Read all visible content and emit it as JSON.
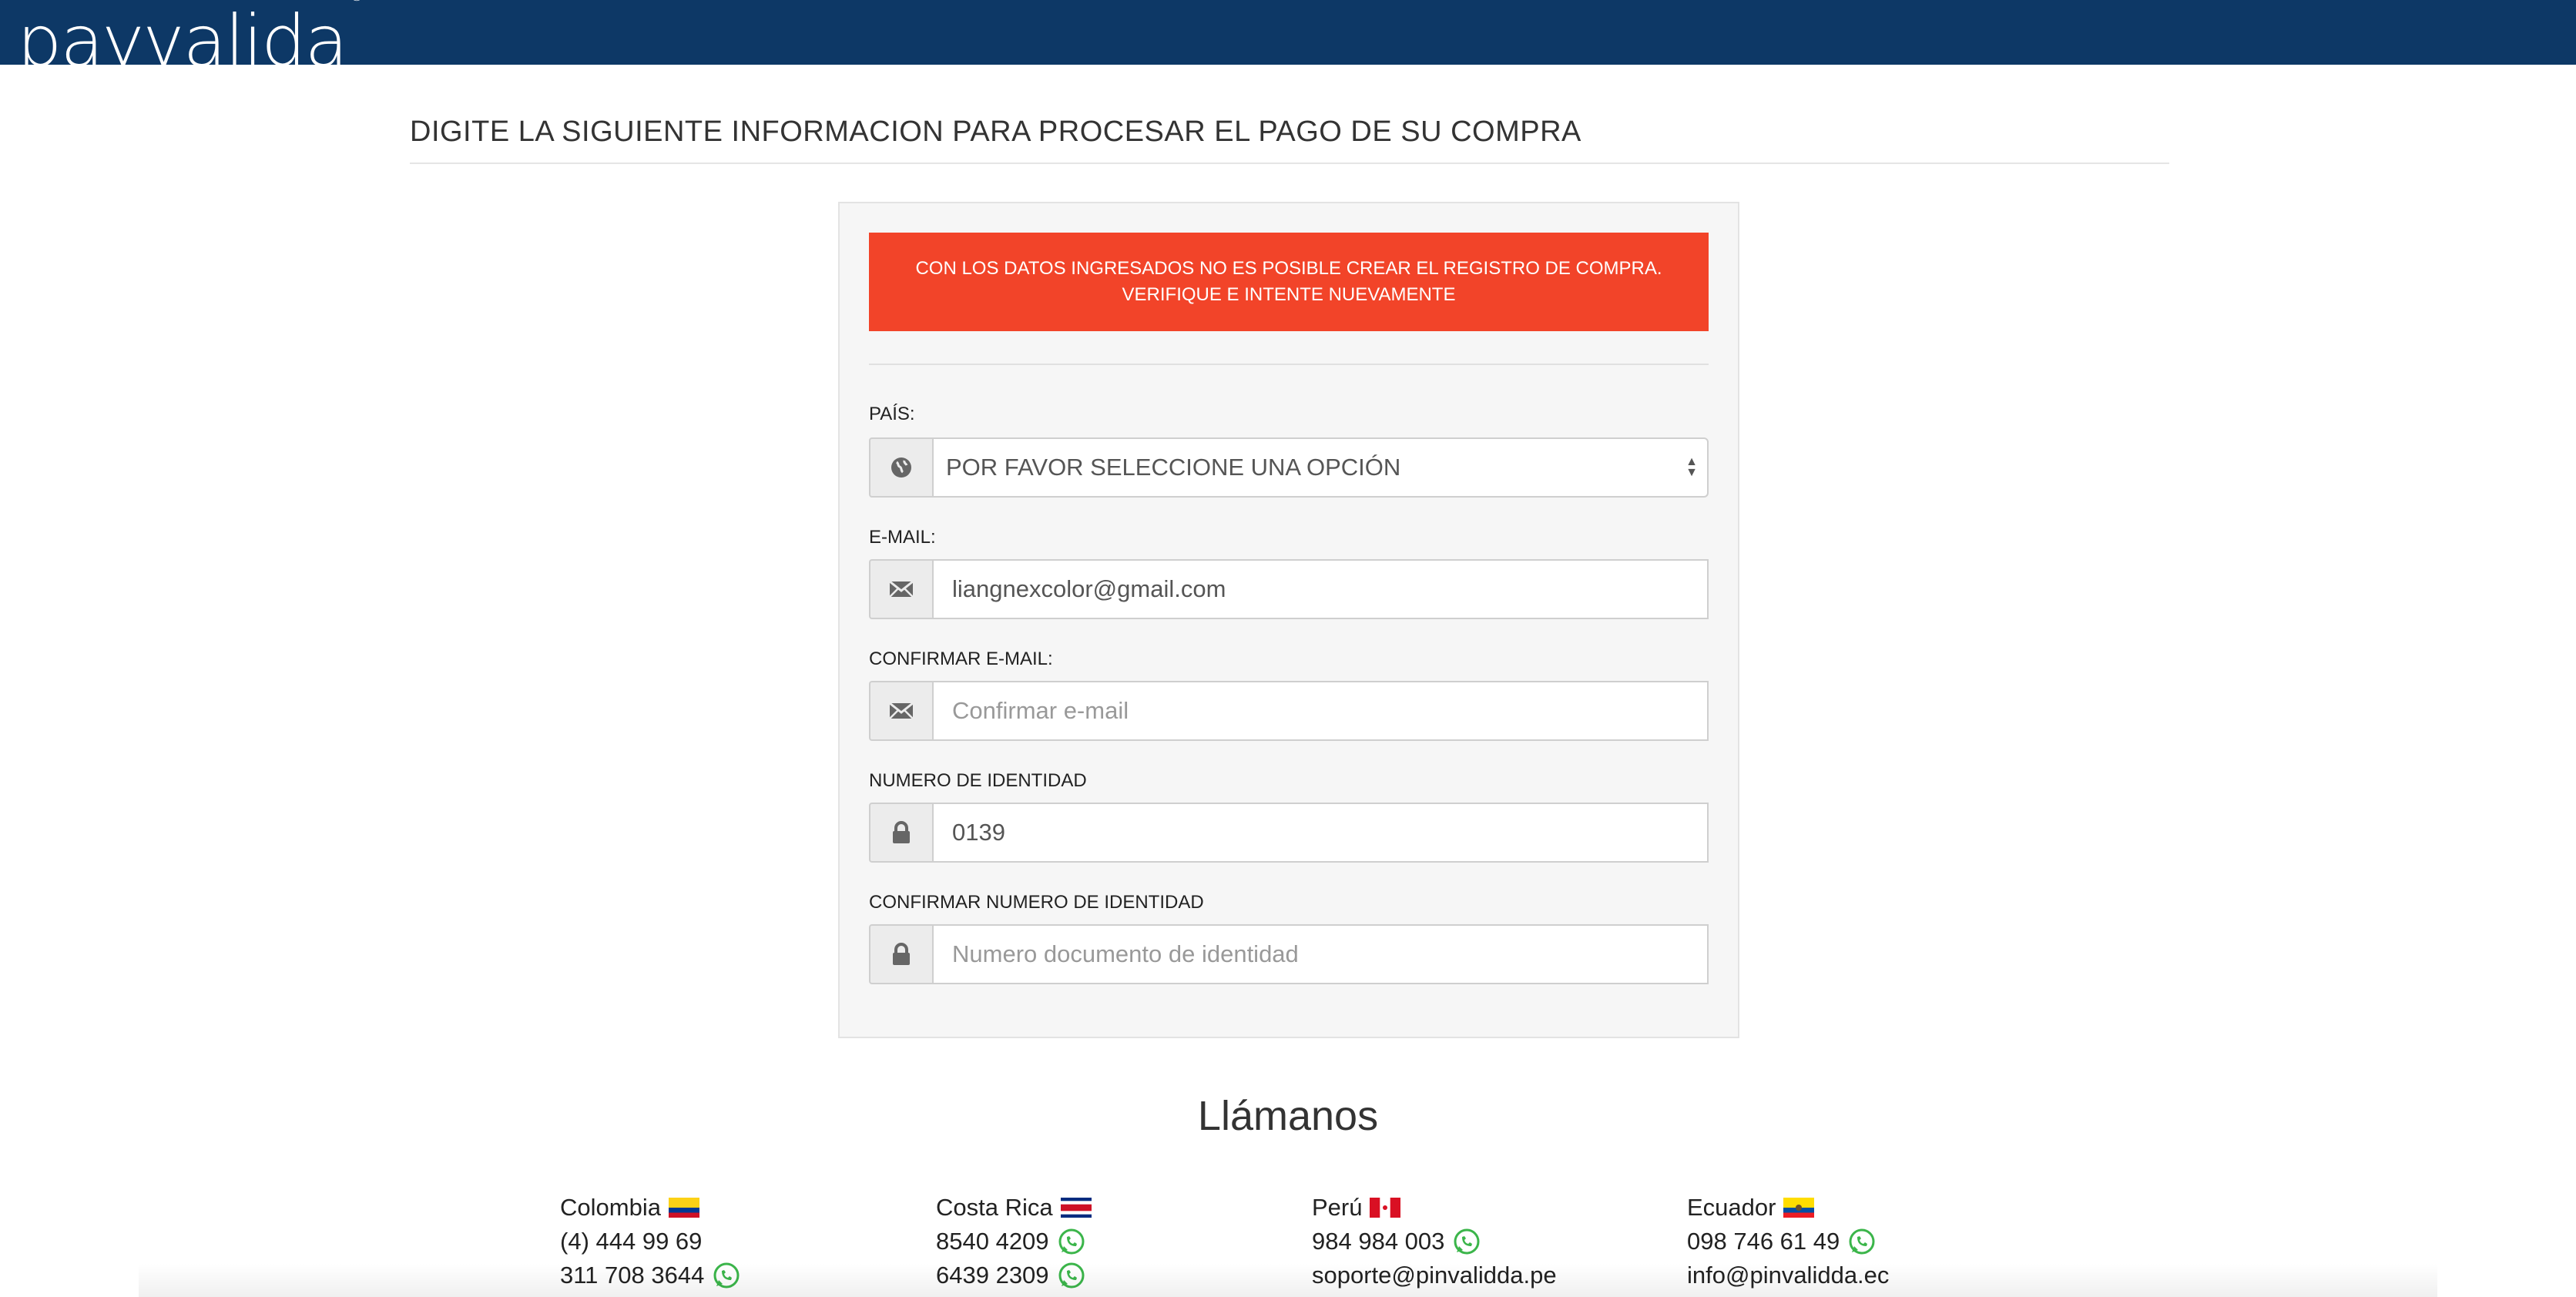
{
  "header": {
    "logo_text": "payvalida",
    "logo_mark": "®",
    "bar_color": "#0d3866"
  },
  "page": {
    "title": "DIGITE LA SIGUIENTE INFORMACION PARA PROCESAR EL PAGO DE SU COMPRA"
  },
  "alert": {
    "message": "CON LOS DATOS INGRESADOS NO ES POSIBLE CREAR EL REGISTRO DE COMPRA. VERIFIQUE E INTENTE NUEVAMENTE",
    "color": "#f24429"
  },
  "form": {
    "country": {
      "label": "PAÍS:",
      "value": "POR FAVOR SELECCIONE UNA OPCIÓN",
      "icon": "globe-icon"
    },
    "email": {
      "label": "E-MAIL:",
      "value": "liangnexcolor@gmail.com",
      "icon": "envelope-icon"
    },
    "confirm_email": {
      "label": "CONFIRMAR E-MAIL:",
      "placeholder": "Confirmar e-mail",
      "value": "",
      "icon": "envelope-icon"
    },
    "id_number": {
      "label": "NUMERO DE IDENTIDAD",
      "value": "0139",
      "icon": "lock-icon"
    },
    "confirm_id": {
      "label": "CONFIRMAR NUMERO DE IDENTIDAD",
      "placeholder": "Numero documento de identidad",
      "value": "",
      "icon": "lock-icon"
    }
  },
  "contact": {
    "title": "Llámanos",
    "countries": [
      {
        "name": "Colombia",
        "lines": [
          "(4) 444 99 69",
          "311 708 3644"
        ]
      },
      {
        "name": "Costa Rica",
        "lines": [
          "8540 4209",
          "6439 2309"
        ]
      },
      {
        "name": "Perú",
        "lines": [
          "984 984 003",
          "soporte@pinvalidda.pe"
        ]
      },
      {
        "name": "Ecuador",
        "lines": [
          "098 746 61 49",
          "info@pinvalidda.ec"
        ]
      }
    ]
  }
}
